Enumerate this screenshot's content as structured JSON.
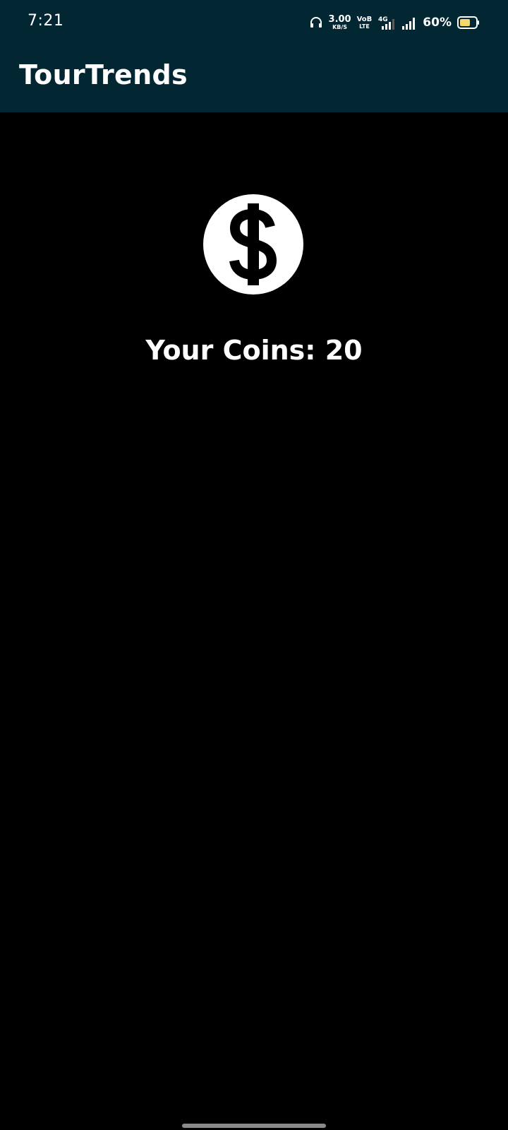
{
  "status_bar": {
    "time": "7:21",
    "net_speed_value": "3.00",
    "net_speed_unit": "KB/S",
    "volte_top": "VoB",
    "volte_bottom": "LTE",
    "network_type": "4G",
    "battery_percent": "60%",
    "icons": [
      "headphones-icon",
      "signal-4g-icon",
      "signal-icon",
      "battery-icon"
    ]
  },
  "header": {
    "title": "TourTrends"
  },
  "main": {
    "coin_icon": "dollar-coin-icon",
    "coins_text": "Your Coins: 20"
  },
  "colors": {
    "header_bg": "#022733",
    "page_bg": "#000000",
    "text": "#ffffff",
    "battery_fill": "#f5d76e"
  }
}
